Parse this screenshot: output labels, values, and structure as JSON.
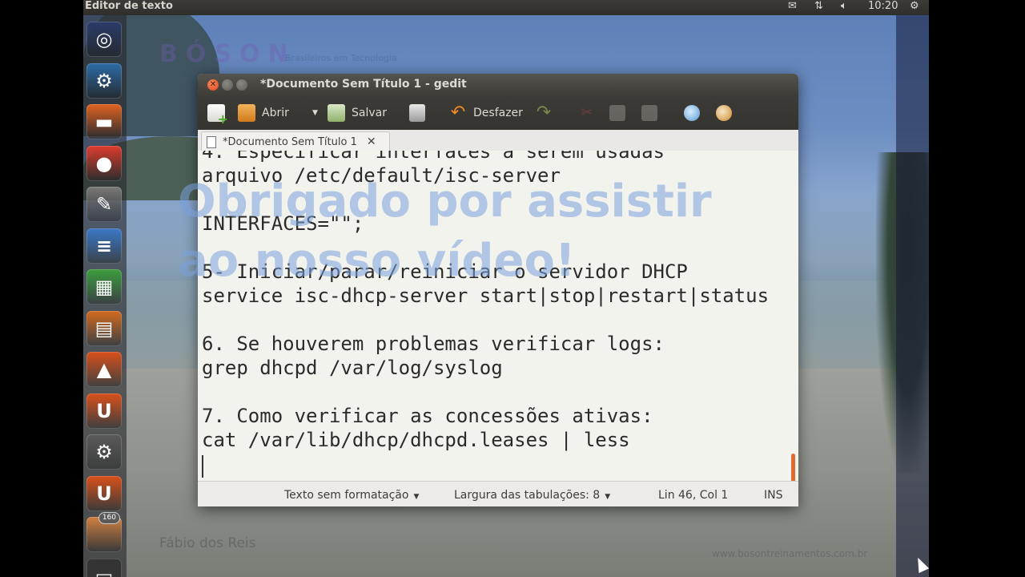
{
  "top_panel": {
    "app_title": "Editor de texto",
    "clock": "10:20",
    "icons": [
      "mail-icon",
      "network-icon",
      "volume-icon",
      "gear-icon"
    ]
  },
  "launcher": {
    "items": [
      {
        "name": "dash-home",
        "glyph": "◎",
        "color": "#2a3b68"
      },
      {
        "name": "python",
        "glyph": "⚙",
        "color": "#2e6ca8"
      },
      {
        "name": "files",
        "glyph": "▬",
        "color": "#e2631f"
      },
      {
        "name": "chrome",
        "glyph": "●",
        "color": "#dd3b2b"
      },
      {
        "name": "text-editor",
        "glyph": "✎",
        "color": "#7a7a78"
      },
      {
        "name": "writer",
        "glyph": "≡",
        "color": "#3b78c7"
      },
      {
        "name": "calc",
        "glyph": "▦",
        "color": "#3d9e3d"
      },
      {
        "name": "impress",
        "glyph": "▤",
        "color": "#d36b1f"
      },
      {
        "name": "software-center",
        "glyph": "▲",
        "color": "#d9501a"
      },
      {
        "name": "ubuntu-one",
        "glyph": "U",
        "color": "#d9501a"
      },
      {
        "name": "settings",
        "glyph": "⚙",
        "color": "#5a5a5a"
      },
      {
        "name": "update-manager",
        "glyph": "U",
        "color": "#d9501a"
      },
      {
        "name": "updates-badge-app",
        "glyph": "",
        "color": "#d08040",
        "badge": "160"
      },
      {
        "name": "terminal",
        "glyph": "▭",
        "color": "#333333"
      }
    ]
  },
  "watermark": {
    "brand": "BÓSON",
    "brand_sub": "Brasileiros em Tecnologia",
    "thanks": "Obrigado por assistir ao nosso vídeo!",
    "author": "Fábio dos Reis",
    "site": "www.bosontreinamentos.com.br"
  },
  "window": {
    "title": "*Documento Sem Título 1 - gedit",
    "toolbar": {
      "open_label": "Abrir",
      "save_label": "Salvar",
      "undo_label": "Desfazer"
    },
    "tab_label": "*Documento Sem Título 1",
    "content": "4. Especificar interfaces a serem usadas\narquivo /etc/default/isc-server\n\nINTERFACES=\"\";\n\n5- Iniciar/parar/reiniciar o servidor DHCP\nservice isc-dhcp-server start|stop|restart|status\n\n6. Se houverem problemas verificar logs:\ngrep dhcpd /var/log/syslog\n\n7. Como verificar as concessões ativas:\ncat /var/lib/dhcp/dhcpd.leases | less\n",
    "status": {
      "syntax": "Texto sem formatação",
      "tab_width": "Largura das tabulações: 8",
      "position": "Lin 46, Col 1",
      "mode": "INS"
    }
  }
}
